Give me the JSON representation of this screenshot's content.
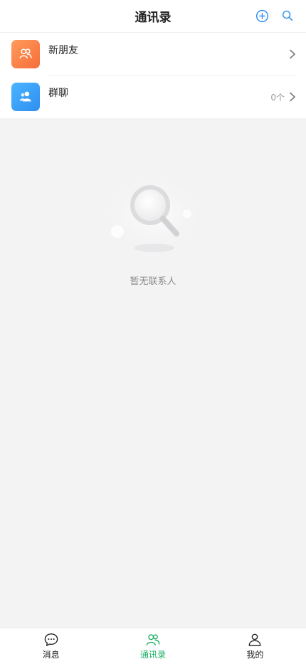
{
  "header": {
    "title": "通讯录",
    "add_icon": "plus-circle-icon",
    "search_icon": "search-icon"
  },
  "list": [
    {
      "label": "新朋友",
      "icon": "users-icon",
      "color": "#f87a43",
      "count": ""
    },
    {
      "label": "群聊",
      "icon": "group-icon",
      "color": "#3f9ff5",
      "count": "0个"
    }
  ],
  "empty": {
    "text": "暂无联系人",
    "icon": "magnifier-illustration"
  },
  "tabbar": {
    "items": [
      {
        "label": "消息",
        "icon": "chat-bubble-icon",
        "active": false
      },
      {
        "label": "通讯录",
        "icon": "contacts-icon",
        "active": true
      },
      {
        "label": "我的",
        "icon": "person-icon",
        "active": false
      }
    ],
    "active_color": "#1aad62"
  },
  "colors": {
    "background": "#f3f3f4",
    "accent": "#2f8ff0"
  }
}
